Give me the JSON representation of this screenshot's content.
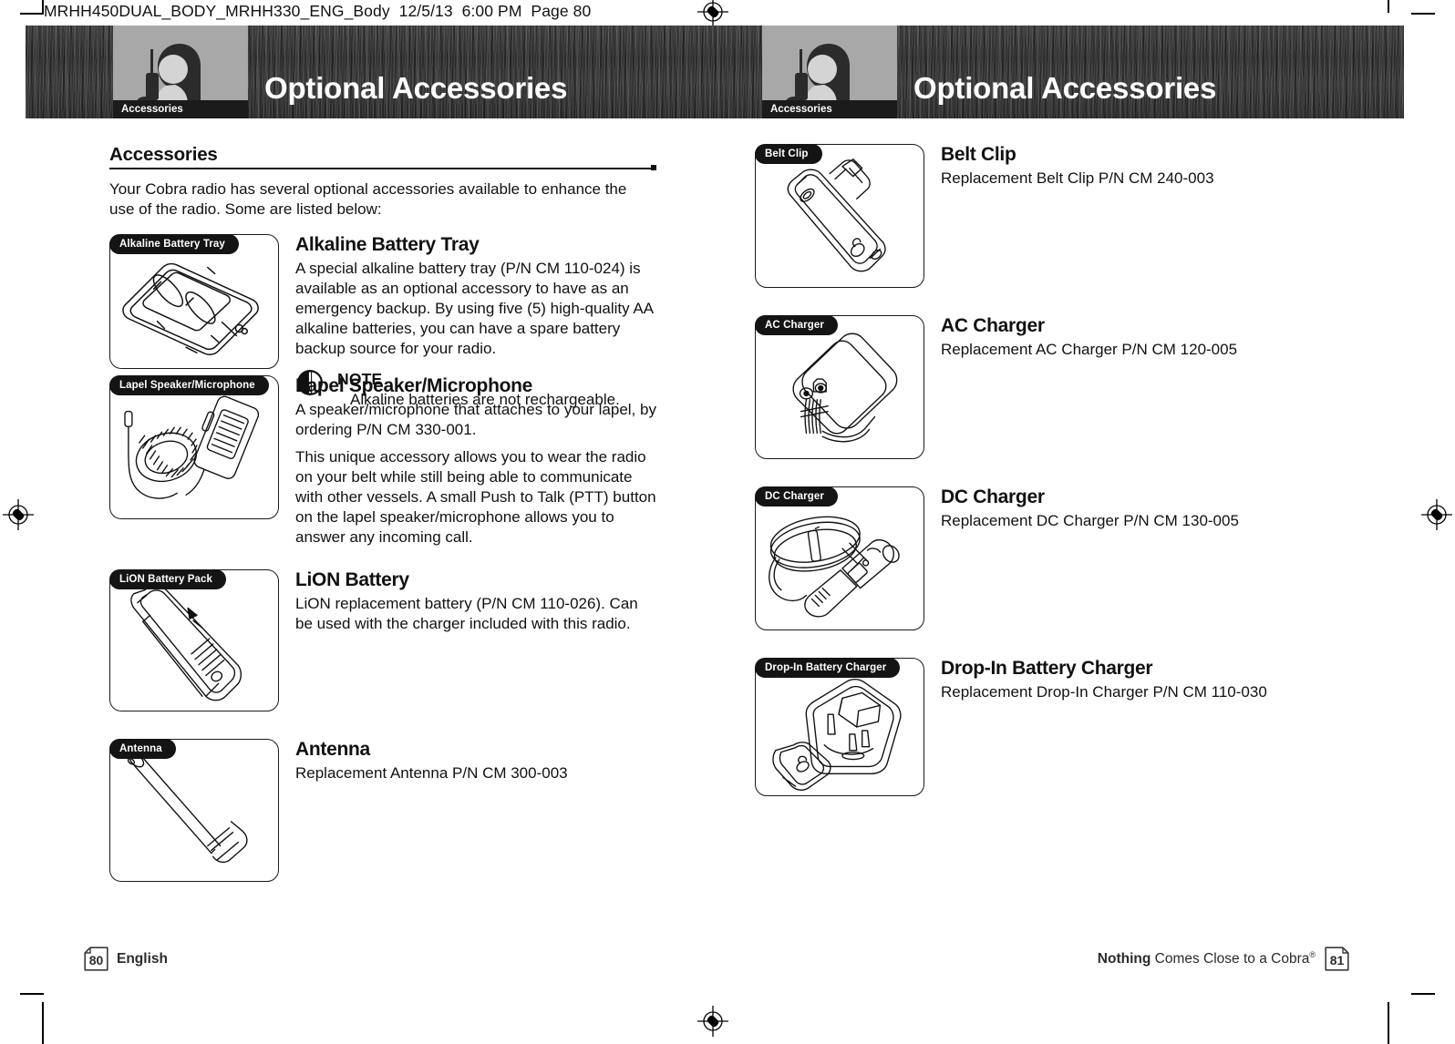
{
  "slug": "MRHH450DUAL_BODY_MRHH330_ENG_Body  12/5/13  6:00 PM  Page 80",
  "banner": {
    "left": {
      "title": "Optional Accessories",
      "tab": "Accessories",
      "icon": "person-with-radio-icon"
    },
    "right": {
      "title": "Optional Accessories",
      "tab": "Accessories",
      "icon": "person-with-radio-icon"
    }
  },
  "left_page": {
    "section": {
      "title": "Accessories"
    },
    "intro": "Your Cobra radio has several optional accessories available to enhance the use of the radio. Some are listed below:",
    "items": [
      {
        "pic_label": "Alkaline Battery Tray",
        "art": "alkaline-battery-tray-illustration",
        "title": "Alkaline Battery Tray",
        "paragraphs": [
          "A special alkaline battery tray (P/N CM 110-024) is available as an optional accessory to have as an emergency backup. By using five (5) high-quality AA alkaline batteries, you can have a spare battery backup source for your radio."
        ]
      },
      {
        "pic_label": "Lapel Speaker/Microphone",
        "art": "lapel-speaker-microphone-illustration",
        "title": "Lapel Speaker/Microphone",
        "paragraphs": [
          "A speaker/microphone that attaches to your lapel, by ordering P/N CM 330-001.",
          "This unique accessory allows you to wear the radio on your belt while still being able to communicate with other vessels. A small Push to Talk (PTT) button on the lapel speaker/microphone allows you to answer any incoming call."
        ]
      },
      {
        "pic_label": "LiON Battery Pack",
        "art": "lion-battery-pack-illustration",
        "title": "LiON Battery",
        "paragraphs": [
          "LiON replacement battery (P/N CM 110-026). Can be used with the charger included with this radio."
        ]
      },
      {
        "pic_label": "Antenna",
        "art": "antenna-illustration",
        "title": "Antenna",
        "paragraphs": [
          "Replacement Antenna P/N CM 300-003"
        ]
      }
    ],
    "note": {
      "icon": "note-circle-icon",
      "label": "NOTE",
      "body": "Alkaline batteries are not rechargeable."
    }
  },
  "right_page": {
    "items": [
      {
        "pic_label": "Belt Clip",
        "art": "belt-clip-illustration",
        "title": "Belt Clip",
        "paragraphs": [
          "Replacement Belt Clip P/N CM 240-003"
        ]
      },
      {
        "pic_label": "AC Charger",
        "art": "ac-charger-illustration",
        "title": "AC Charger",
        "paragraphs": [
          "Replacement AC Charger P/N CM 120-005"
        ]
      },
      {
        "pic_label": "DC Charger",
        "art": "dc-charger-illustration",
        "title": "DC Charger",
        "paragraphs": [
          "Replacement DC Charger P/N CM 130-005"
        ]
      },
      {
        "pic_label": "Drop-In Battery Charger",
        "art": "drop-in-battery-charger-illustration",
        "title": "Drop-In Battery Charger",
        "paragraphs": [
          "Replacement Drop-In Charger P/N CM 110-030"
        ]
      }
    ]
  },
  "footer": {
    "left_page_number": "80",
    "language": "English",
    "tagline_bold": "Nothing",
    "tagline_rest": " Comes Close to a Cobra",
    "tagline_mark": "®",
    "right_page_number": "81"
  },
  "colors": {
    "ink": "#111111",
    "banner_dark": "#2e2e2e",
    "banner_icon_block": "#a8a8a8",
    "chip_black": "#141414",
    "paper": "#ffffff"
  }
}
